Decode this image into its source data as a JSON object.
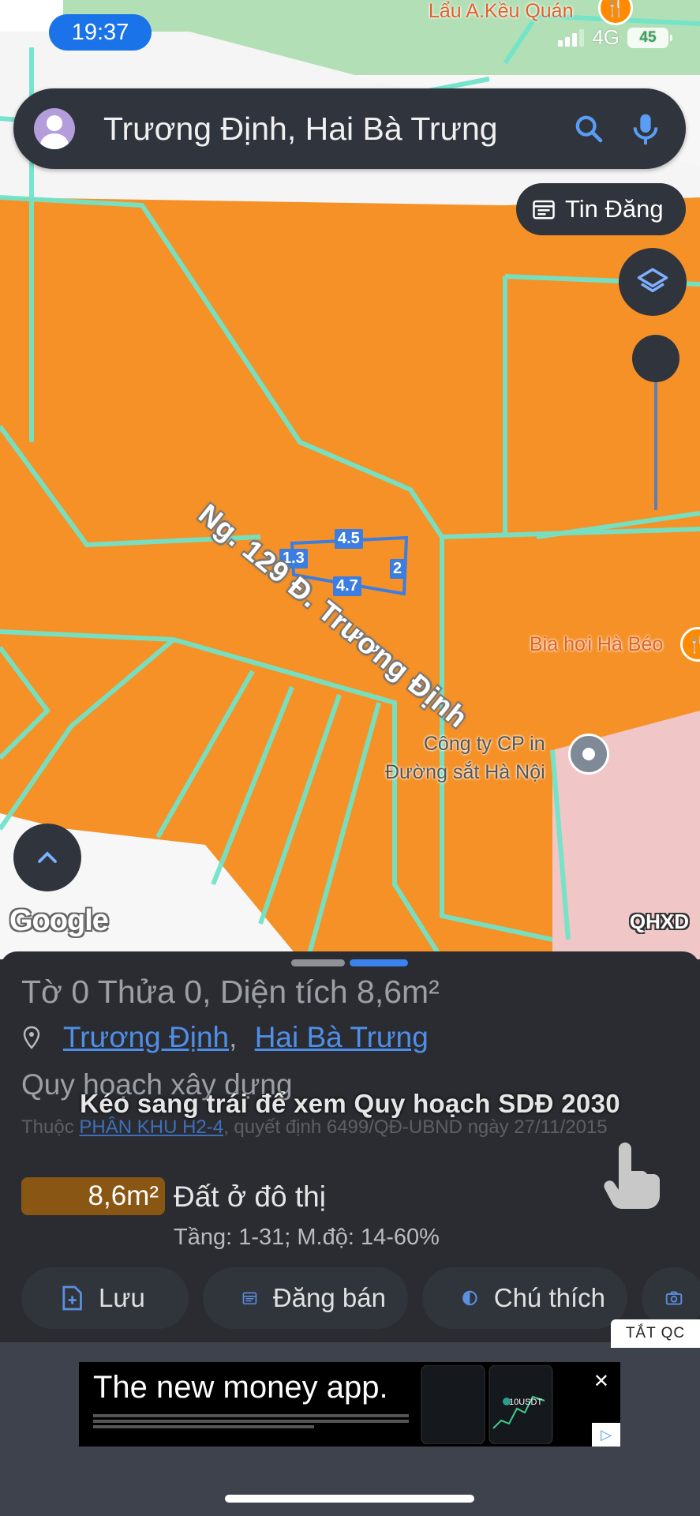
{
  "status_bar": {
    "time": "19:37",
    "network": "4G",
    "battery": "45"
  },
  "search": {
    "query": "Trương Định, Hai Bà Trưng"
  },
  "map": {
    "tin_dang_label": "Tin Đăng",
    "road_name": "Ng. 129 Đ. Trương Định",
    "parcel_dimensions": [
      "4.5",
      "1.3",
      "2",
      "4.7"
    ],
    "pois": [
      {
        "name": "Lẩu A.Kều Quán",
        "icon": "restaurant-icon"
      },
      {
        "name": "Bia hơi Hà Béo",
        "icon": "restaurant-icon"
      },
      {
        "name_line1": "Công ty CP in",
        "name_line2": "Đường sắt Hà Nội",
        "icon": "location-pin-icon"
      }
    ],
    "google_logo": "Google",
    "layer_code": "QHXD",
    "colors": {
      "residential_land": "#f59127",
      "parcel_border": "#71e4c9",
      "other_zone": "#f0c6c6",
      "park": "#b3dfb6"
    }
  },
  "sheet": {
    "parcel_title": "Tờ 0 Thửa 0, Diện tích 8,6m²",
    "address_street": "Trương Định",
    "address_district": "Hai Bà Trưng",
    "address_separator": ",",
    "plan_heading": "Quy hoạch xây dựng",
    "plan_prefix": "Thuộc",
    "plan_zone": "PHÂN KHU H2-4",
    "plan_suffix": ", quyết định 6499/QĐ-UBND ngày 27/11/2015",
    "swipe_hint": "Kéo sang trái để xem Quy hoạch SDĐ 2030",
    "area": "8,6m²",
    "land_type": "Đất ở đô thị",
    "land_details": "Tầng: 1-31; M.độ: 14-60%",
    "actions": [
      {
        "label": "Lưu",
        "icon": "file-plus-icon"
      },
      {
        "label": "Đăng bán",
        "icon": "calendar-icon"
      },
      {
        "label": "Chú thích",
        "icon": "contrast-icon"
      }
    ]
  },
  "ad": {
    "hide_label": "TẮT QC",
    "headline": "The new money app.",
    "coin_text": "10USDT"
  }
}
